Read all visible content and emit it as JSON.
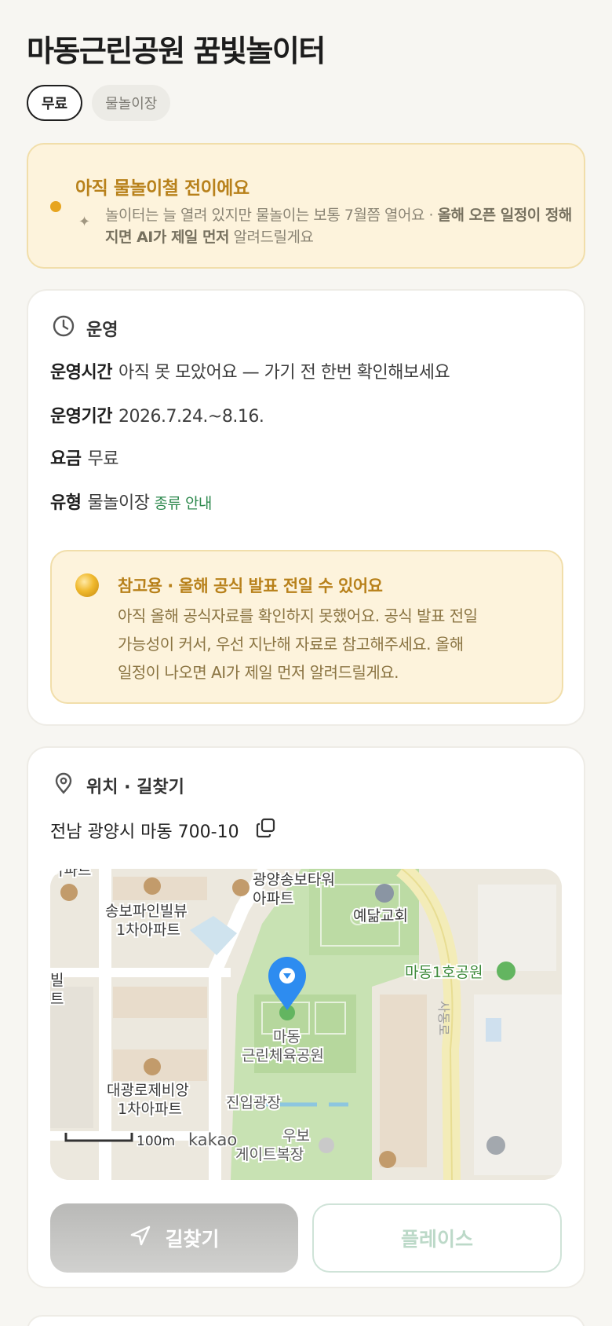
{
  "page": {
    "title": "마동근린공원 꿈빛놀이터",
    "chips": [
      "무료",
      "물놀이장"
    ]
  },
  "notice": {
    "heading": "아직 물놀이철 전이에요",
    "body_plain": "놀이터는 늘 열려 있지만 물놀이는 보통 7월쯤 열어요 · ",
    "body_bold": "올해 오픈 일정이 정해지면 AI가 제일 먼저",
    "body_tail": " 알려드릴게요"
  },
  "operation": {
    "section_title": "운영",
    "rows": [
      {
        "key": "운영시간",
        "value": "아직 못 모았어요 — 가기 전 한번 확인해보세요"
      },
      {
        "key": "운영기간",
        "value": "2026.7.24.~8.16."
      },
      {
        "key": "요금",
        "value": "무료"
      },
      {
        "key": "유형",
        "value": "물놀이장",
        "link": "종류 안내"
      }
    ],
    "reference": {
      "heading": "참고용 · 올해 공식 발표 전일 수 있어요",
      "lines": [
        "아직 올해 공식자료를 확인하지 못했어요. 공식 발표 전일",
        "가능성이 커서, 우선 지난해 자료로 참고해주세요. 올해",
        "일정이 나오면 AI가 제일 먼저 알려드릴게요."
      ]
    }
  },
  "location": {
    "section_title": "위치 · 길찾기",
    "address": "전남 광양시 마동 700-10",
    "map": {
      "labels": {
        "tower": "광양송보타워",
        "tower2": "아파트",
        "church": "예닮교회",
        "songbo": "송보파인빌뷰",
        "songbo2": "1차아파트",
        "park1": "마동1호공원",
        "sports": "마동",
        "sports2": "근린체육공원",
        "road": "사동로",
        "daegwang": "대광로제비앙",
        "daegwang2": "1차아파트",
        "plaza": "진입광장",
        "gate": "우보",
        "gate2": "게이트복장",
        "edge_top": "아파트",
        "edge_left": "빌",
        "edge_left2": "트",
        "scale": "100m",
        "brand": "kakao"
      }
    },
    "directions_label": "길찾기",
    "place_label": "플레이스"
  },
  "colors": {
    "accent_gold": "#b8811b",
    "link_green": "#2f8a4f",
    "pin_blue": "#2d8cf0"
  }
}
